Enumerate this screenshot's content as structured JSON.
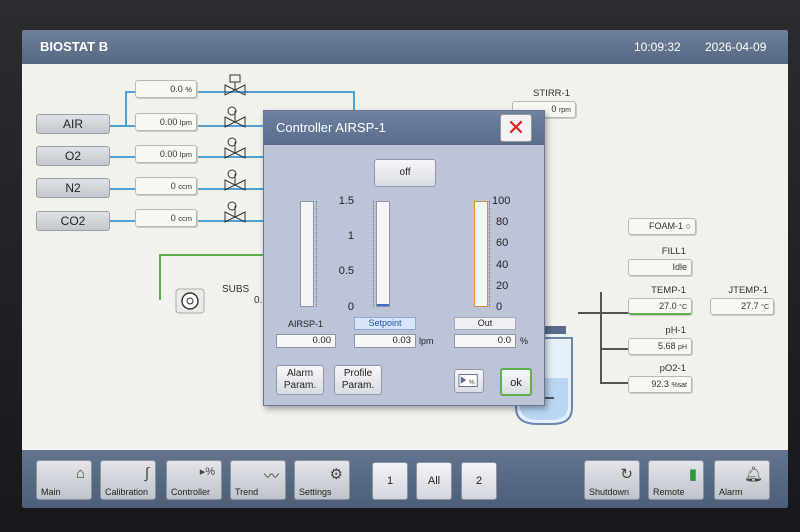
{
  "header": {
    "title": "BIOSTAT B",
    "time": "10:09:32",
    "date": "2026-04-09"
  },
  "gases": [
    {
      "name": "AIR",
      "value": "0.00",
      "unit": "lpm"
    },
    {
      "name": "O2",
      "value": "0.00",
      "unit": "lpm"
    },
    {
      "name": "N2",
      "value": "0",
      "unit": "ccm"
    },
    {
      "name": "CO2",
      "value": "0",
      "unit": "ccm"
    }
  ],
  "top_flow": {
    "value": "0.0",
    "unit": "%"
  },
  "stirrer": {
    "name": "STIRR-1",
    "value": "0",
    "unit": "rpm"
  },
  "substrate": {
    "name": "SUBS",
    "value": "0."
  },
  "tags": {
    "foam": {
      "name": "FOAM-1"
    },
    "fill": {
      "name": "FILL1",
      "value": "Idle"
    },
    "temp": {
      "name": "TEMP-1",
      "value": "27.0",
      "unit": "°C"
    },
    "jtemp": {
      "name": "JTEMP-1",
      "value": "27.7",
      "unit": "°C"
    },
    "ph": {
      "name": "pH-1",
      "value": "5.68",
      "unit": "pH"
    },
    "po2": {
      "name": "pO2-1",
      "value": "92.3",
      "unit": "%sat"
    }
  },
  "dialog": {
    "title": "Controller AIRSP-1",
    "close_icon": "close-icon",
    "mode_label": "off",
    "left_scale": [
      "1.5",
      "1",
      "0.5",
      "0"
    ],
    "right_scale": [
      "100",
      "80",
      "60",
      "40",
      "20",
      "0"
    ],
    "pv_label": "AIRSP-1",
    "pv_value": "0.00",
    "sp_label": "Setpoint",
    "sp_value": "0.03",
    "sp_unit": "lpm",
    "out_label": "Out",
    "out_value": "0.0",
    "out_unit": "%",
    "setpoint_fraction": 0.02,
    "pv_fraction": 0.0,
    "out_fraction": 0.0,
    "alarm_label_1": "Alarm",
    "alarm_label_2": "Param.",
    "profile_label_1": "Profile",
    "profile_label_2": "Param.",
    "ok_label": "ok"
  },
  "nav": {
    "main": "Main",
    "calibration": "Calibration",
    "controller": "Controller",
    "trend": "Trend",
    "settings": "Settings",
    "page1": "1",
    "page_all": "All",
    "page2": "2",
    "shutdown": "Shutdown",
    "remote": "Remote",
    "alarm": "Alarm"
  },
  "colors": {
    "accent": "#5a6c8b",
    "pipe": "#4fa0d6",
    "green_line": "#5fb04a",
    "close": "#d22222"
  }
}
